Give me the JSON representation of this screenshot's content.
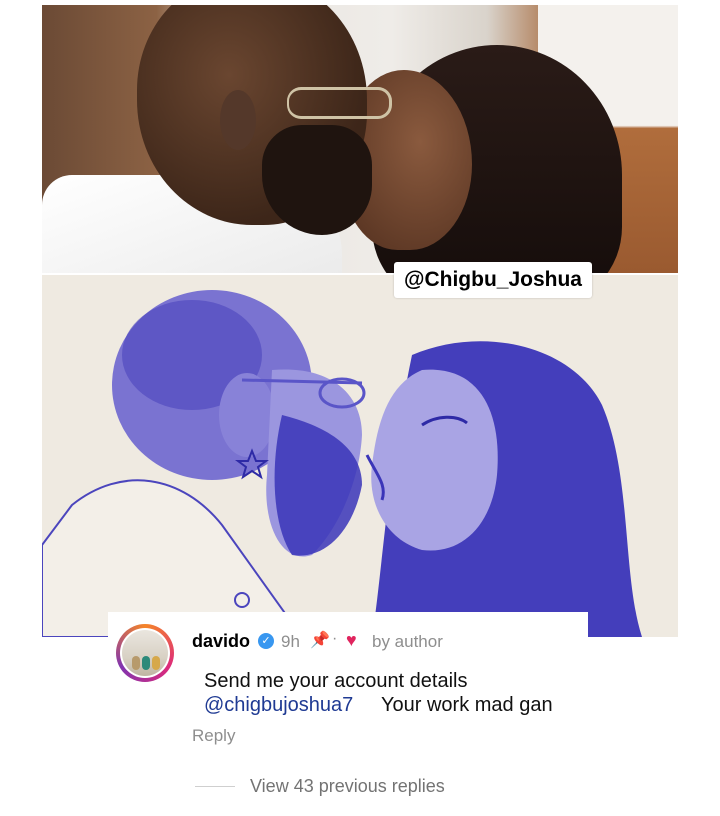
{
  "watermark": "@Chigbu_Joshua",
  "comment": {
    "username": "davido",
    "verified_icon": "verified-badge-icon",
    "time": "9h",
    "pin_icon": "pin-icon",
    "separator": "·",
    "heart_icon": "heart-icon",
    "author_label": "by author",
    "text_line1": "Send me your account details",
    "mention": "@chigbujoshua7",
    "text_rest": "Your work mad gan",
    "reply_label": "Reply"
  },
  "view_replies": "View 43 previous replies",
  "colors": {
    "mention": "#1f3a93",
    "verified": "#3897f0",
    "heart": "#e0245e",
    "muted": "#8e8e8e",
    "pen_ink": "#3a35b8"
  }
}
